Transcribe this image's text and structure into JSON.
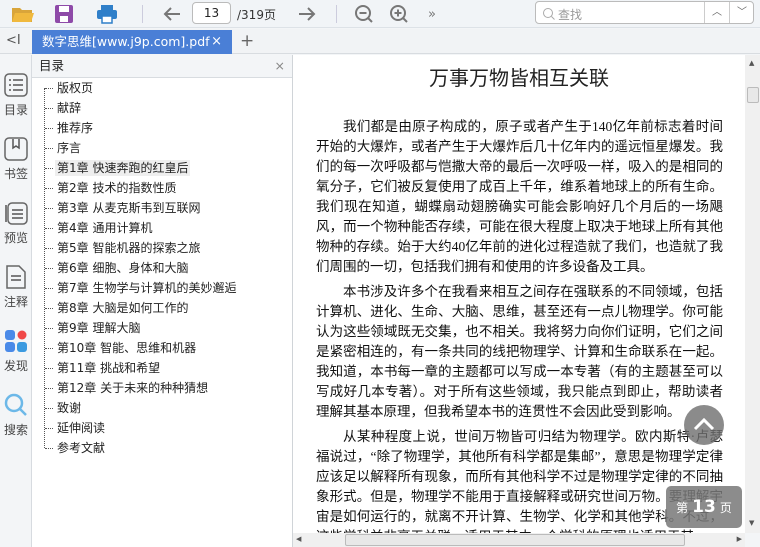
{
  "toolbar": {
    "page_current": "13",
    "page_total": "/319页",
    "search_placeholder": "查找",
    "icons": [
      "open-folder-icon",
      "save-icon",
      "print-icon",
      "arrow-left-icon",
      "arrow-right-icon",
      "zoom-out-icon",
      "zoom-in-icon",
      "more-icon"
    ]
  },
  "tabs": [
    {
      "label": "数字思维[www.j9p.com].pdf",
      "close": "×"
    }
  ],
  "tab_add": "+",
  "collapse": "<I",
  "rail": [
    {
      "label": "目录"
    },
    {
      "label": "书签"
    },
    {
      "label": "预览"
    },
    {
      "label": "注释"
    },
    {
      "label": "发现"
    },
    {
      "label": "搜索"
    }
  ],
  "toc": {
    "title": "目录",
    "close": "×",
    "items": [
      "版权页",
      "献辞",
      "推荐序",
      "序言",
      "第1章 快速奔跑的红皇后",
      "第2章 技术的指数性质",
      "第3章 从麦克斯韦到互联网",
      "第4章 通用计算机",
      "第5章 智能机器的探索之旅",
      "第6章 细胞、身体和大脑",
      "第7章 生物学与计算机的美妙邂逅",
      "第8章 大脑是如何工作的",
      "第9章 理解大脑",
      "第10章 智能、思维和机器",
      "第11章 挑战和希望",
      "第12章 关于未来的种种猜想",
      "致谢",
      "延伸阅读",
      "参考文献"
    ],
    "active_index": 4
  },
  "document": {
    "title": "万事万物皆相互关联",
    "paragraphs": [
      "我们都是由原子构成的，原子或者产生于140亿年前标志着时间开始的大爆炸，或者产生于大爆炸后几十亿年内的遥远恒星爆发。我们的每一次呼吸都与恺撒大帝的最后一次呼吸一样，吸入的是相同的氧分子，它们被反复使用了成百上千年，维系着地球上的所有生命。我们现在知道，蝴蝶扇动翅膀确实可能会影响好几个月后的一场飓风，而一个物种能否存续，可能在很大程度上取决于地球上所有其他物种的存续。始于大约40亿年前的进化过程造就了我们，也造就了我们周围的一切，包括我们拥有和使用的许多设备及工具。",
      "本书涉及许多个在我看来相互之间存在强联系的不同领域，包括计算机、进化、生命、大脑、思维，甚至还有一点儿物理学。你可能认为这些领域既无交集，也不相关。我将努力向你们证明，它们之间是紧密相连的，有一条共同的线把物理学、计算和生命联系在一起。我知道，本书每一章的主题都可以写成一本专著（有的主题甚至可以写成好几本专著）。对于所有这些领域，我只能点到即止，帮助读者理解其基本原理，但我希望本书的连贯性不会因此受到影响。",
      "从某种程度上说，世间万物皆可归结为物理学。欧内斯特·卢瑟福说过，“除了物理学，其他所有科学都是集邮”，意思是物理学定律应该足以解释所有现象，而所有其他科学不过是物理学定律的不同抽象形式。但是，物理学不能用于直接解释或研究世间万物。要理解宇宙是如何运行的，就离不开计算、生物学、化学和其他学科。不过，这些学科并非毫无关联，适用于其中一个学科的原理也适用于其"
    ]
  },
  "page_badge": {
    "prefix": "第",
    "number": "13",
    "suffix": "页"
  },
  "colors": {
    "accent": "#4a7fd6"
  }
}
